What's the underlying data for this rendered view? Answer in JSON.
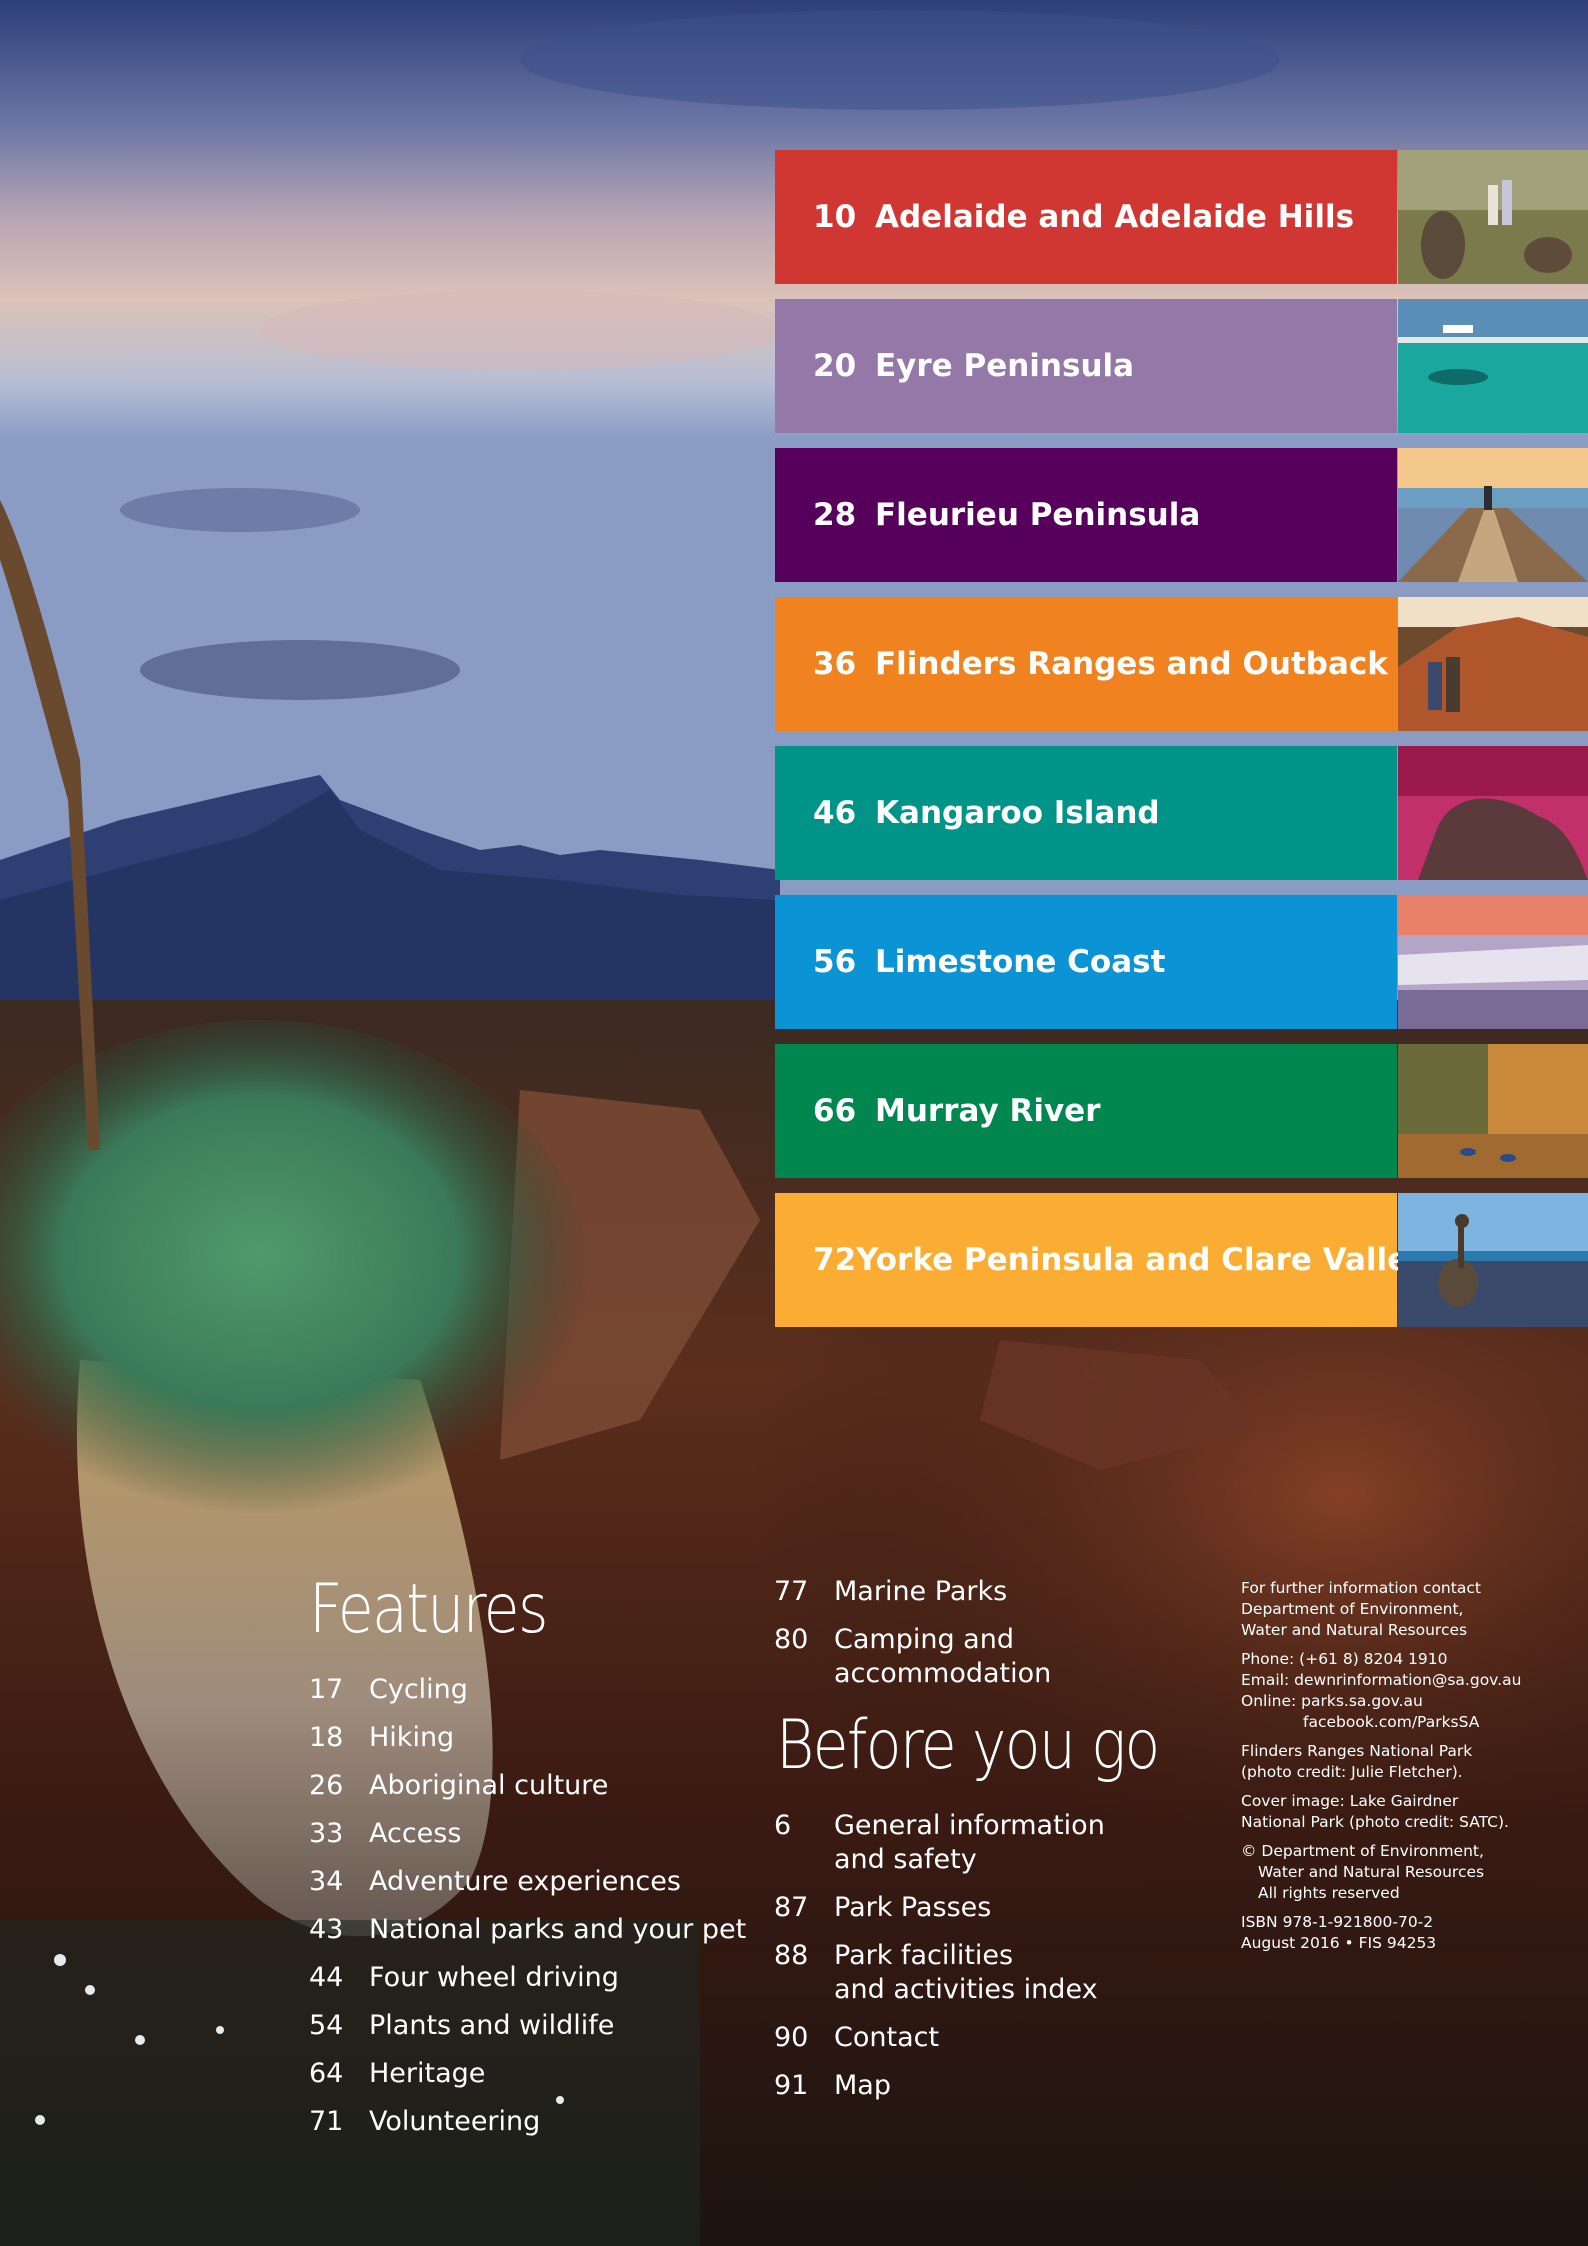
{
  "regions": [
    {
      "page": "10",
      "title": "Adelaide and Adelaide Hills",
      "color": "#d13732",
      "thumb": "kangaroos-icon"
    },
    {
      "page": "20",
      "title": "Eyre Peninsula",
      "color": "#9478a8",
      "thumb": "ocean-icon"
    },
    {
      "page": "28",
      "title": "Fleurieu Peninsula",
      "color": "#56005c",
      "thumb": "jetty-icon"
    },
    {
      "page": "36",
      "title": "Flinders Ranges and Outback",
      "color": "#f08220",
      "thumb": "ranges-icon"
    },
    {
      "page": "46",
      "title": "Kangaroo Island",
      "color": "#009488",
      "thumb": "rocks-icon"
    },
    {
      "page": "56",
      "title": "Limestone Coast",
      "color": "#0a94d6",
      "thumb": "coast-icon"
    },
    {
      "page": "66",
      "title": "Murray River",
      "color": "#00874f",
      "thumb": "river-icon"
    },
    {
      "page": "72",
      "title": "Yorke Peninsula and Clare Valley",
      "color": "#fbad33",
      "thumb": "emu-icon"
    }
  ],
  "features": {
    "heading": "Features",
    "items": [
      {
        "page": "17",
        "label": "Cycling"
      },
      {
        "page": "18",
        "label": "Hiking"
      },
      {
        "page": "26",
        "label": "Aboriginal culture"
      },
      {
        "page": "33",
        "label": "Access"
      },
      {
        "page": "34",
        "label": "Adventure experiences"
      },
      {
        "page": "43",
        "label": "National parks and your pet"
      },
      {
        "page": "44",
        "label": "Four wheel driving"
      },
      {
        "page": "54",
        "label": "Plants and wildlife"
      },
      {
        "page": "64",
        "label": "Heritage"
      },
      {
        "page": "71",
        "label": "Volunteering"
      }
    ]
  },
  "features_continued": {
    "items": [
      {
        "page": "77",
        "line1": "Marine Parks",
        "line2": ""
      },
      {
        "page": "80",
        "line1": "Camping and",
        "line2": "accommodation"
      }
    ]
  },
  "before_you_go": {
    "heading": "Before you go",
    "items": [
      {
        "page": "6",
        "line1": "General information",
        "line2": "and safety"
      },
      {
        "page": "87",
        "line1": "Park Passes",
        "line2": ""
      },
      {
        "page": "88",
        "line1": "Park facilities",
        "line2": "and activities index"
      },
      {
        "page": "90",
        "line1": "Contact",
        "line2": ""
      },
      {
        "page": "91",
        "line1": "Map",
        "line2": ""
      }
    ]
  },
  "info": {
    "contact_l1": "For further information contact",
    "contact_l2": "Department of Environment,",
    "contact_l3": "Water and Natural Resources",
    "phone": "Phone: (+61 8) 8204 1910",
    "email": "Email:  dewnrinformation@sa.gov.au",
    "online": "Online: parks.sa.gov.au",
    "facebook": "facebook.com/ParksSA",
    "photo_l1": "Flinders Ranges National Park",
    "photo_l2": "(photo credit: Julie Fletcher).",
    "cover_l1": "Cover image: Lake Gairdner",
    "cover_l2": "National Park (photo credit: SATC).",
    "copy_l1": "© Department of Environment,",
    "copy_l2": "Water and Natural Resources",
    "copy_l3": "All rights reserved",
    "isbn": "ISBN 978-1-921800-70-2",
    "date": "August 2016 • FIS 94253"
  }
}
